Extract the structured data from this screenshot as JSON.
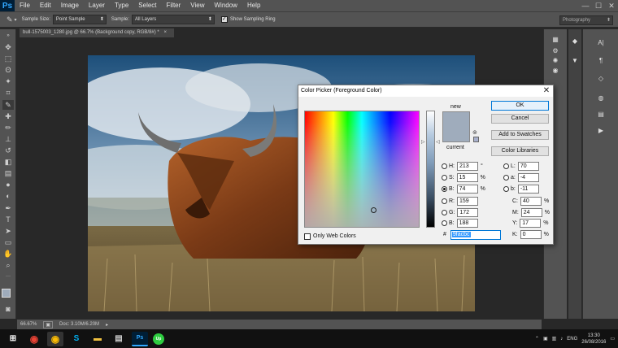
{
  "app": {
    "logo": "Ps"
  },
  "menu": [
    "File",
    "Edit",
    "Image",
    "Layer",
    "Type",
    "Select",
    "Filter",
    "View",
    "Window",
    "Help"
  ],
  "window_controls": [
    "—",
    "☐",
    "✕"
  ],
  "options": {
    "sample_size_label": "Sample Size:",
    "sample_size_value": "Point Sample",
    "sample_label": "Sample:",
    "sample_value": "All Layers",
    "show_ring_label": "Show Sampling Ring",
    "workspace": "Photography"
  },
  "document": {
    "tab_title": "bull-1575003_1280.jpg @ 66.7% (Background copy, RGB/8#) *",
    "close": "×"
  },
  "status": {
    "zoom": "66.67%",
    "doc_info": "Doc: 3.10M/6.20M"
  },
  "dialog": {
    "title": "Color Picker (Foreground Color)",
    "close": "✕",
    "new_label": "new",
    "current_label": "current",
    "buttons": {
      "ok": "OK",
      "cancel": "Cancel",
      "add_swatches": "Add to Swatches",
      "libraries": "Color Libraries"
    },
    "fields": {
      "H": {
        "label": "H:",
        "value": "213",
        "unit": "°"
      },
      "S": {
        "label": "S:",
        "value": "15",
        "unit": "%"
      },
      "B": {
        "label": "B:",
        "value": "74",
        "unit": "%"
      },
      "R": {
        "label": "R:",
        "value": "159"
      },
      "G": {
        "label": "G:",
        "value": "172"
      },
      "Bl": {
        "label": "B:",
        "value": "188"
      },
      "L": {
        "label": "L:",
        "value": "70"
      },
      "a": {
        "label": "a:",
        "value": "-4"
      },
      "b": {
        "label": "b:",
        "value": "-11"
      },
      "C": {
        "label": "C:",
        "value": "40",
        "unit": "%"
      },
      "M": {
        "label": "M:",
        "value": "24",
        "unit": "%"
      },
      "Y": {
        "label": "Y:",
        "value": "17",
        "unit": "%"
      },
      "K": {
        "label": "K:",
        "value": "0",
        "unit": "%"
      }
    },
    "hex_prefix": "#",
    "hex_value": "9facbc",
    "web_colors_label": "Only Web Colors",
    "selected_color": "#9facbc"
  },
  "taskbar": {
    "lang": "ENG",
    "time": "13:30",
    "date": "26/08/2016"
  },
  "colors": {
    "ps_bg": "#282828",
    "panel": "#535353",
    "accent": "#31a8ff"
  }
}
